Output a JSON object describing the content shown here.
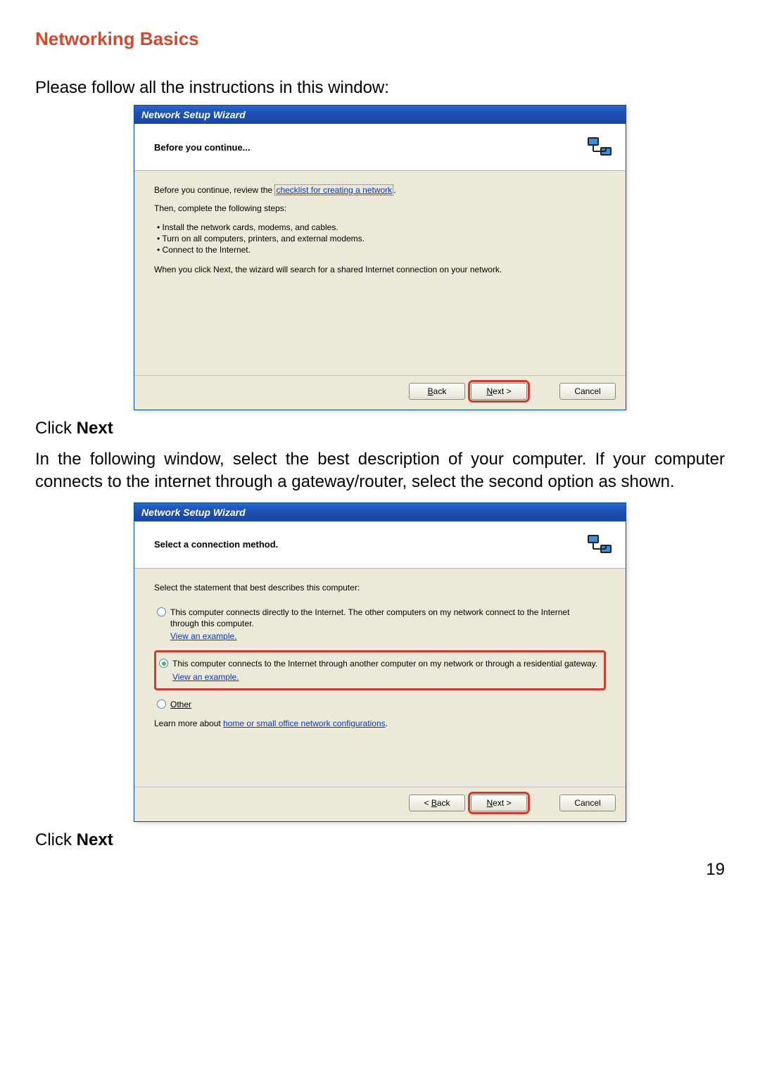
{
  "doc": {
    "heading": "Networking Basics",
    "instruction1": "Please follow all the instructions in this window:",
    "click_prefix": "Click ",
    "click_next_word": "Next",
    "paragraph2": "In the following window, select the best description of your computer.  If your computer connects to the internet through a gateway/router, select the second option as shown.",
    "page_number": "19"
  },
  "wizard1": {
    "title": "Network Setup Wizard",
    "header": "Before you continue...",
    "line_lead": "Before you continue, review the ",
    "line_link": "checklist for creating a network",
    "line_trail": ".",
    "then_line": "Then, complete the following steps:",
    "steps": [
      "Install the network cards, modems, and cables.",
      "Turn on all computers, printers, and external modems.",
      "Connect to the Internet."
    ],
    "final_line": "When you click Next, the wizard will search for a shared Internet connection on your network.",
    "buttons": {
      "back": "< Back",
      "next": "Next >",
      "cancel": "Cancel"
    }
  },
  "wizard2": {
    "title": "Network Setup Wizard",
    "header": "Select a connection method.",
    "prompt": "Select the statement that best describes this computer:",
    "options": [
      {
        "text": "This computer connects directly to the Internet. The other computers on my network connect to the Internet through this computer.",
        "example": "View an example.",
        "checked": false,
        "highlighted": false
      },
      {
        "text": "This computer connects to the Internet through another computer on my network or through a residential gateway.",
        "example": "View an example.",
        "checked": true,
        "highlighted": true
      },
      {
        "text": "Other",
        "example": "",
        "checked": false,
        "highlighted": false
      }
    ],
    "learn_lead": "Learn more about ",
    "learn_link": "home or small office network configurations",
    "learn_trail": ".",
    "buttons": {
      "back": "< Back",
      "next": "Next >",
      "cancel": "Cancel"
    }
  }
}
